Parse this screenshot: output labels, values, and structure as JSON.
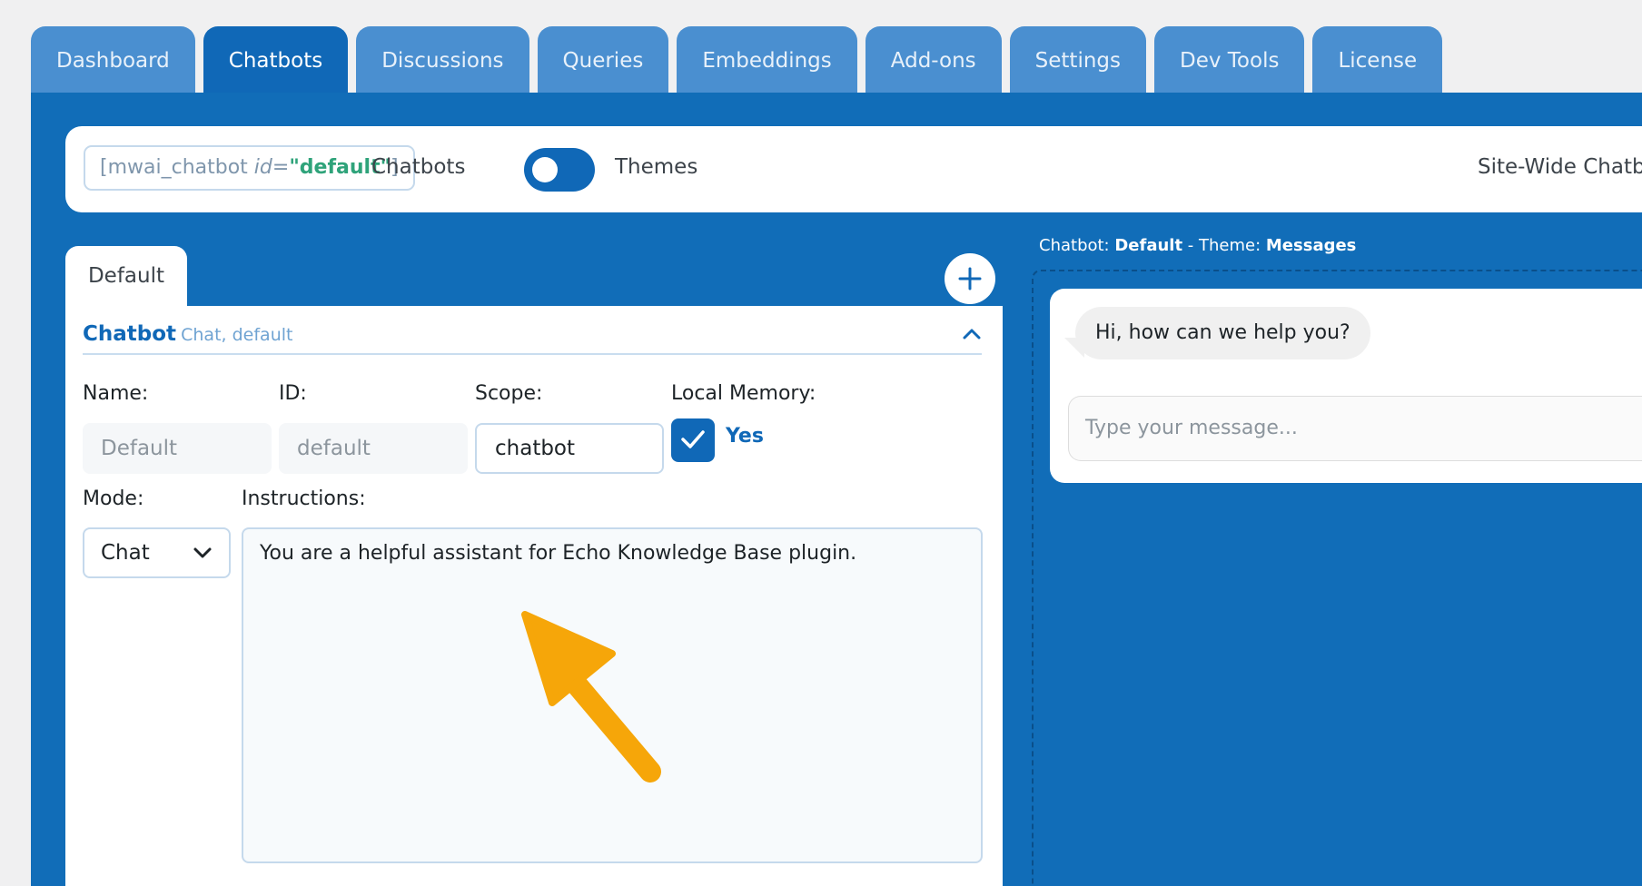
{
  "tabs": [
    {
      "label": "Dashboard",
      "active": false
    },
    {
      "label": "Chatbots",
      "active": true
    },
    {
      "label": "Discussions",
      "active": false
    },
    {
      "label": "Queries",
      "active": false
    },
    {
      "label": "Embeddings",
      "active": false
    },
    {
      "label": "Add-ons",
      "active": false
    },
    {
      "label": "Settings",
      "active": false
    },
    {
      "label": "Dev Tools",
      "active": false
    },
    {
      "label": "License",
      "active": false
    }
  ],
  "topbar": {
    "shortcode_prefix": "[mwai_chatbot ",
    "shortcode_attr": "id",
    "shortcode_eq": "=",
    "shortcode_value": "\"default\"",
    "shortcode_suffix": "]",
    "toggle_left_label": "Chatbots",
    "toggle_right_label": "Themes",
    "toggle_state": "chatbots",
    "sitewide_label": "Site-Wide Chatbot:"
  },
  "chatbot_tabs": [
    {
      "label": "Default",
      "active": true
    }
  ],
  "section": {
    "title": "Chatbot",
    "subtitle": "Chat, default"
  },
  "fields": {
    "name": {
      "label": "Name:",
      "value": "Default"
    },
    "id": {
      "label": "ID:",
      "value": "default"
    },
    "scope": {
      "label": "Scope:",
      "value": "chatbot"
    },
    "local_memory": {
      "label": "Local Memory:",
      "checked": true,
      "checkbox_label": "Yes"
    },
    "mode": {
      "label": "Mode:",
      "value": "Chat"
    },
    "instructions": {
      "label": "Instructions:",
      "value": "You are a helpful assistant for Echo Knowledge Base plugin."
    }
  },
  "preview": {
    "chatbot_prefix": "Chatbot: ",
    "chatbot_name": "Default",
    "theme_prefix": " - Theme: ",
    "theme_name": "Messages",
    "greeting": "Hi, how can we help you?",
    "input_placeholder": "Type your message..."
  },
  "colors": {
    "accent": "#1068b7",
    "tab_inactive": "#4a8fd0",
    "panel": "#116db8",
    "annotation_arrow": "#f6a609"
  }
}
